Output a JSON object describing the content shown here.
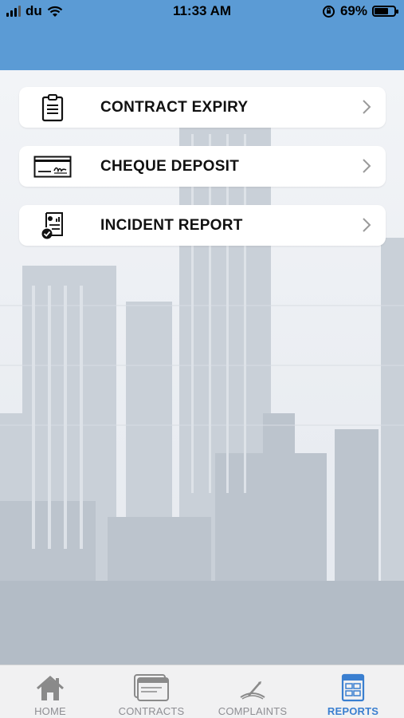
{
  "status_bar": {
    "carrier": "du",
    "time": "11:33 AM",
    "battery_percent": "69%",
    "battery_level": 0.69,
    "icons": [
      "signal-icon",
      "wifi-icon",
      "rotation-lock-icon",
      "battery-icon"
    ]
  },
  "colors": {
    "header": "#5b9bd5",
    "tab_active": "#3a7fd0",
    "tab_inactive": "#8e8e93"
  },
  "menu": {
    "items": [
      {
        "label": "CONTRACT EXPIRY",
        "icon": "clipboard-icon"
      },
      {
        "label": "CHEQUE DEPOSIT",
        "icon": "cheque-icon"
      },
      {
        "label": "INCIDENT REPORT",
        "icon": "report-icon"
      }
    ]
  },
  "tabbar": {
    "tabs": [
      {
        "label": "HOME",
        "icon": "home-icon",
        "active": false
      },
      {
        "label": "CONTRACTS",
        "icon": "contracts-icon",
        "active": false
      },
      {
        "label": "COMPLAINTS",
        "icon": "complaints-icon",
        "active": false
      },
      {
        "label": "REPORTS",
        "icon": "reports-icon",
        "active": true
      }
    ]
  }
}
